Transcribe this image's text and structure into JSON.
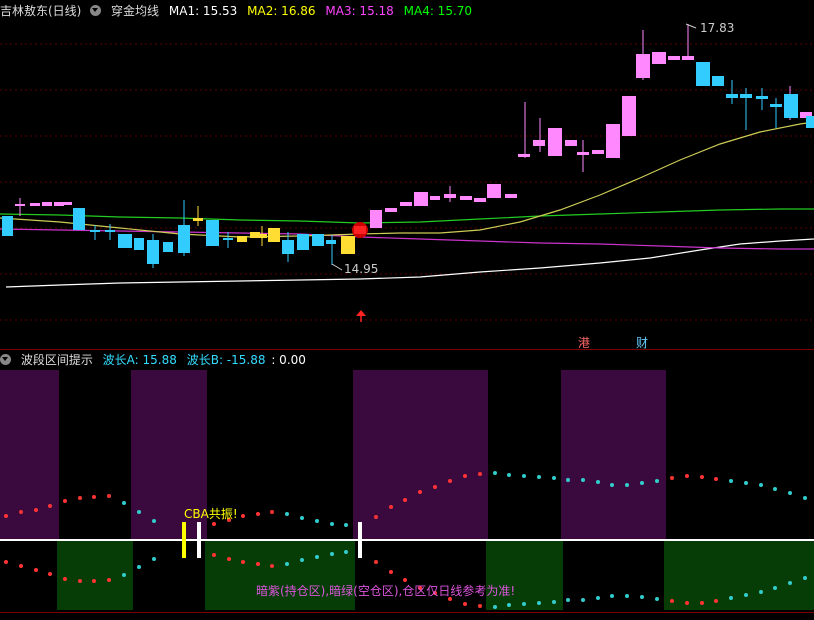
{
  "top_panel": {
    "stock_name": "吉林敖东(日线)",
    "indicator": "穿金均线",
    "ma1": {
      "label": "MA1: 15.53",
      "color": "#ffffff"
    },
    "ma2": {
      "label": "MA2: 16.86",
      "color": "#ffff00"
    },
    "ma3": {
      "label": "MA3: 15.18",
      "color": "#ff44ff"
    },
    "ma4": {
      "label": "MA4: 15.70",
      "color": "#00ff00"
    },
    "high_label": "17.83",
    "low_label": "14.95",
    "tag_gang": "港",
    "tag_cai": "财"
  },
  "bottom_panel": {
    "indicator": "波段区间提示",
    "wave_a": "波长A: 15.88",
    "wave_b": "波长B: -15.88",
    "extra": ": 0.00",
    "cba_label": "CBA共振!",
    "note": "暗紫(持仓区),暗绿(空仓区),仓区仅日线参考为准!"
  },
  "colors": {
    "up": "#ff88ff",
    "down": "#33ccff",
    "yellow": "#ffdd33",
    "dark_purple": "#3a0a3e",
    "dark_green": "#063d06"
  }
}
